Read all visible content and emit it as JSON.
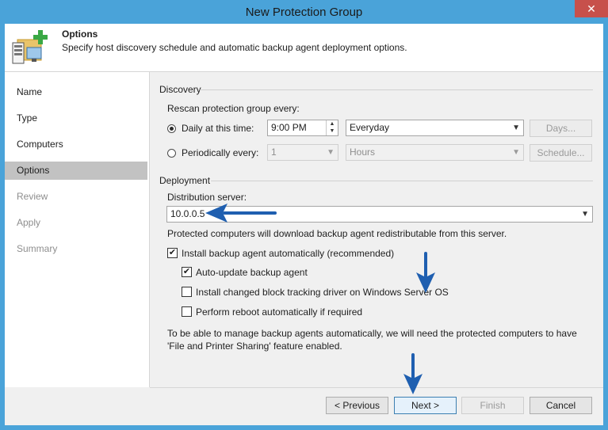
{
  "window": {
    "title": "New Protection Group",
    "close_glyph": "✕"
  },
  "header": {
    "title": "Options",
    "subtitle": "Specify host discovery schedule and automatic backup agent deployment options.",
    "icon": "protection-group-add-icon"
  },
  "sidebar": {
    "items": [
      {
        "label": "Name",
        "state": "normal"
      },
      {
        "label": "Type",
        "state": "normal"
      },
      {
        "label": "Computers",
        "state": "normal"
      },
      {
        "label": "Options",
        "state": "selected"
      },
      {
        "label": "Review",
        "state": "disabled"
      },
      {
        "label": "Apply",
        "state": "disabled"
      },
      {
        "label": "Summary",
        "state": "disabled"
      }
    ]
  },
  "discovery": {
    "section_title": "Discovery",
    "rescan_label": "Rescan protection group every:",
    "daily_label": "Daily at this time:",
    "daily_time": "9:00 PM",
    "daily_frequency": "Everyday",
    "days_button": "Days...",
    "periodically_label": "Periodically every:",
    "period_value": "1",
    "period_unit": "Hours",
    "schedule_button": "Schedule...",
    "selected_option": "daily"
  },
  "deployment": {
    "section_title": "Deployment",
    "distribution_label": "Distribution server:",
    "distribution_value": "10.0.0.5",
    "distribution_note": "Protected computers will download backup agent redistributable from this server.",
    "install_agent_label": "Install backup agent automatically (recommended)",
    "install_agent_checked": true,
    "auto_update_label": "Auto-update backup agent",
    "auto_update_checked": true,
    "cbt_label": "Install changed block tracking driver on Windows Server OS",
    "cbt_checked": false,
    "reboot_label": "Perform reboot automatically if required",
    "reboot_checked": false,
    "note_line1": "To be able to manage backup agents automatically, we will need the protected computers to have",
    "note_line2": "'File and Printer Sharing' feature enabled."
  },
  "footer": {
    "previous": "< Previous",
    "next": "Next >",
    "finish": "Finish",
    "cancel": "Cancel"
  },
  "colors": {
    "titlebar": "#4aa3d9",
    "close": "#c7504b",
    "annotation_arrow": "#1f5fb0"
  }
}
